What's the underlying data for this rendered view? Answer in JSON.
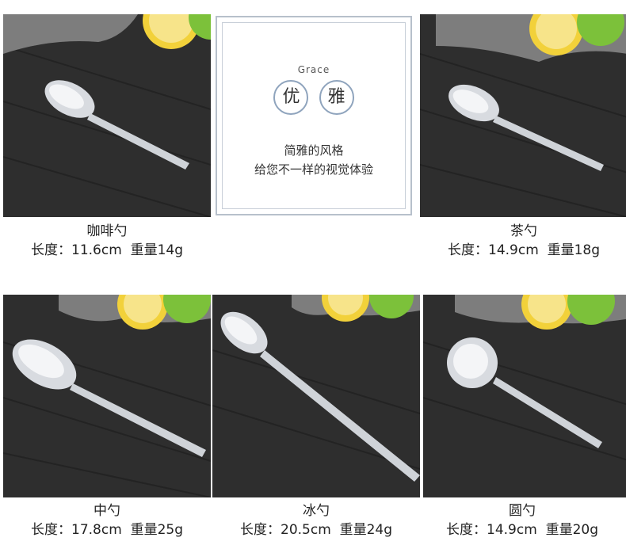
{
  "card": {
    "subtitle": "Grace",
    "char1": "优",
    "char2": "雅",
    "line1": "简雅的风格",
    "line2": "给您不一样的视觉体验"
  },
  "products": [
    {
      "name": "咖啡勺",
      "spec": "长度：11.6cm  重量14g"
    },
    {
      "name": "茶勺",
      "spec": "长度：14.9cm  重量18g"
    },
    {
      "name": "中勺",
      "spec": "长度：17.8cm  重量25g"
    },
    {
      "name": "冰勺",
      "spec": "长度：20.5cm  重量24g"
    },
    {
      "name": "圆勺",
      "spec": "长度：14.9cm  重量20g"
    }
  ],
  "colors": {
    "wood": "#2b2b2b",
    "lemon": "#f2d13a",
    "lime": "#7cc13a",
    "steel": "#d8dbe0",
    "border": "#b7c0cb"
  }
}
